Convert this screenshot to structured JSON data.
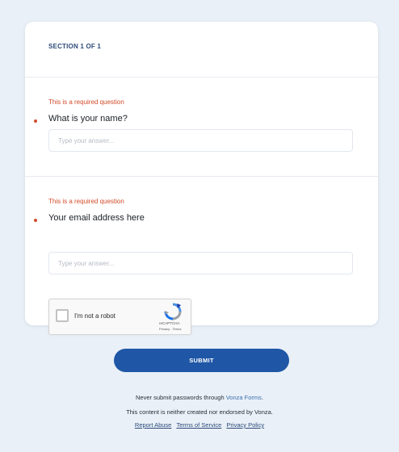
{
  "section": {
    "label": "SECTION 1 OF 1"
  },
  "questions": [
    {
      "required_message": "This is a required question",
      "title": "What is your name?",
      "placeholder": "Type your answer...",
      "value": ""
    },
    {
      "required_message": "This is a required question",
      "title": "Your email address here",
      "placeholder": "Type your answer...",
      "value": ""
    }
  ],
  "recaptcha": {
    "label": "I'm not a robot",
    "brand": "reCAPTCHA",
    "terms": "Privacy - Terms",
    "checked": false
  },
  "submit_label": "SUBMIT",
  "footer": {
    "line1_prefix": "Never submit passwords through ",
    "line1_link": "Vonza Forms",
    "line1_suffix": ".",
    "line2": "This content is neither created nor endorsed by Vonza.",
    "links": [
      "Report Abuse",
      "Terms of Service",
      "Privacy Policy"
    ]
  },
  "colors": {
    "background": "#e9f0f7",
    "accent": "#1f57a6",
    "required": "#d24b2a"
  }
}
